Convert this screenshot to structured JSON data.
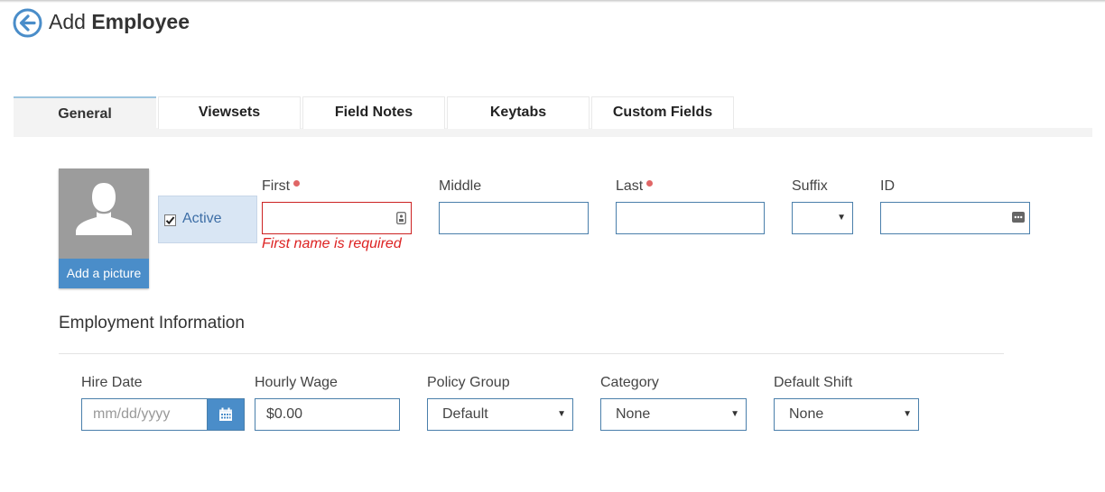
{
  "header": {
    "title_prefix": "Add",
    "title_bold": "Employee"
  },
  "tabs": [
    {
      "label": "General",
      "active": true
    },
    {
      "label": "Viewsets"
    },
    {
      "label": "Field Notes"
    },
    {
      "label": "Keytabs"
    },
    {
      "label": "Custom Fields"
    }
  ],
  "photo": {
    "add_label": "Add a picture"
  },
  "active": {
    "label": "Active",
    "checked": true
  },
  "name_fields": {
    "first": {
      "label": "First",
      "value": "",
      "required": true,
      "error": "First name is required"
    },
    "middle": {
      "label": "Middle",
      "value": ""
    },
    "last": {
      "label": "Last",
      "value": "",
      "required": true
    },
    "suffix": {
      "label": "Suffix",
      "value": ""
    },
    "id": {
      "label": "ID",
      "value": ""
    }
  },
  "employment": {
    "title": "Employment Information",
    "hire_date": {
      "label": "Hire Date",
      "placeholder": "mm/dd/yyyy"
    },
    "hourly_wage": {
      "label": "Hourly Wage",
      "value": "$0.00"
    },
    "policy_group": {
      "label": "Policy Group",
      "value": "Default"
    },
    "category": {
      "label": "Category",
      "value": "None"
    },
    "default_shift": {
      "label": "Default Shift",
      "value": "None"
    }
  },
  "colors": {
    "accent": "#4a8dc9",
    "error": "#dd2222",
    "required": "#e06666"
  }
}
